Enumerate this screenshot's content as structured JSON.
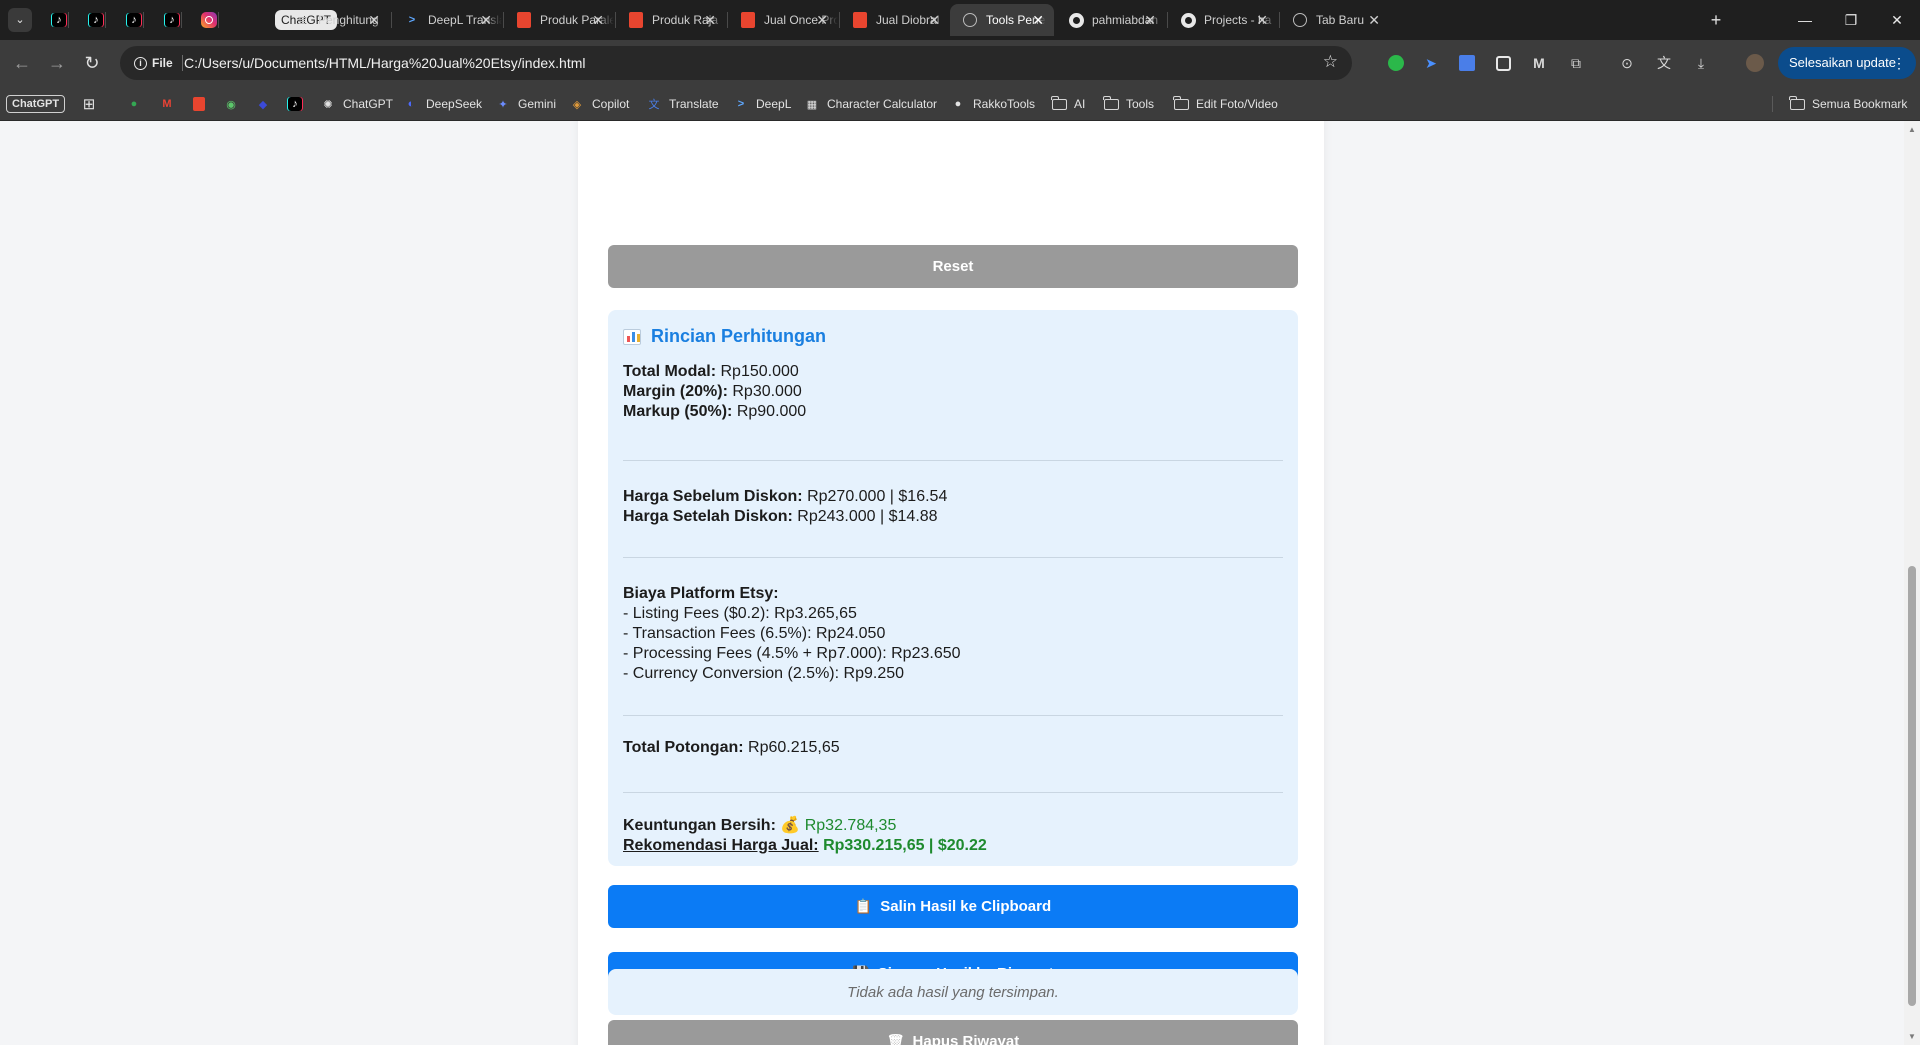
{
  "browser": {
    "pinned_tabs": [
      {
        "icon": "tiktok-icon",
        "glyph": "♪"
      },
      {
        "icon": "tiktok-icon",
        "glyph": "♪"
      },
      {
        "icon": "tiktok-icon",
        "glyph": "♪"
      },
      {
        "icon": "tiktok-icon",
        "glyph": "♪"
      },
      {
        "icon": "instagram-icon",
        "glyph": ""
      }
    ],
    "chip_label": "ChatGPT",
    "tabs": [
      {
        "title": "Penghitung",
        "icon": "document-icon"
      },
      {
        "title": "DeepL Translate",
        "icon": "deepl-icon"
      },
      {
        "title": "Produk Paralel",
        "icon": "shopee-icon"
      },
      {
        "title": "Produk Raja",
        "icon": "shopee-icon"
      },
      {
        "title": "Jual Once Pro",
        "icon": "shopee-icon"
      },
      {
        "title": "Jual Diobral",
        "icon": "shopee-icon"
      },
      {
        "title": "Tools Penentu",
        "icon": "globe-icon",
        "active": true
      },
      {
        "title": "pahmiabdan",
        "icon": "github-icon"
      },
      {
        "title": "Projects - ha",
        "icon": "github-icon"
      },
      {
        "title": "Tab Baru",
        "icon": "globe-icon"
      }
    ],
    "omnibox": {
      "scheme_label": "File",
      "url": "C:/Users/u/Documents/HTML/Harga%20Jual%20Etsy/index.html"
    },
    "update_label": "Selesaikan update",
    "bookmarks": [
      {
        "label": "ChatGPT",
        "icon": "chatgpt-icon"
      },
      {
        "label": "DeepSeek",
        "icon": "deepseek-icon"
      },
      {
        "label": "Gemini",
        "icon": "gemini-icon"
      },
      {
        "label": "Copilot",
        "icon": "copilot-icon"
      },
      {
        "label": "Translate",
        "icon": "translate-icon"
      },
      {
        "label": "DeepL",
        "icon": "deepl-icon"
      },
      {
        "label": "Character Calculator",
        "icon": "character-calculator-icon"
      },
      {
        "label": "RakkoTools",
        "icon": "rakkotools-icon"
      },
      {
        "label": "AI",
        "icon": "folder-icon"
      },
      {
        "label": "Tools",
        "icon": "folder-icon"
      },
      {
        "label": "Edit Foto/Video",
        "icon": "folder-icon"
      }
    ],
    "all_bookmarks_label": "Semua Bookmark"
  },
  "page": {
    "reset_label": "Reset",
    "result": {
      "title": "Rincian Perhitungan",
      "total_modal_label": "Total Modal:",
      "total_modal_value": "Rp150.000",
      "margin_label": "Margin (20%):",
      "margin_value": "Rp30.000",
      "markup_label": "Markup (50%):",
      "markup_value": "Rp90.000",
      "price_before_label": "Harga Sebelum Diskon:",
      "price_before_value": "Rp270.000 | $16.54",
      "price_after_label": "Harga Setelah Diskon:",
      "price_after_value": "Rp243.000 | $14.88",
      "fees_label": "Biaya Platform Etsy:",
      "fees": [
        "- Listing Fees ($0.2): Rp3.265,65",
        "- Transaction Fees (6.5%): Rp24.050",
        "- Processing Fees (4.5% + Rp7.000): Rp23.650",
        "- Currency Conversion (2.5%): Rp9.250"
      ],
      "total_cut_label": "Total Potongan:",
      "total_cut_value": "Rp60.215,65",
      "profit_label": "Keuntungan Bersih:",
      "profit_icon": "💰",
      "profit_value": "Rp32.784,35",
      "recommend_label": "Rekomendasi Harga Jual:",
      "recommend_value": "Rp330.215,65 | $20.22"
    },
    "copy_label": "Salin Hasil ke Clipboard",
    "copy_icon": "📋",
    "save_label": "Simpan Hasil ke Riwayat",
    "save_icon": "💾",
    "delete_label": "Hapus Riwayat",
    "delete_icon": "🗑",
    "empty_history": "Tidak ada hasil yang tersimpan."
  },
  "colors": {
    "accent": "#0b7bf5",
    "title_blue": "#1a7fe0",
    "profit_green": "#1e8a2e",
    "result_bg": "#e6f2fd",
    "gray_button": "#9a9a9a"
  }
}
